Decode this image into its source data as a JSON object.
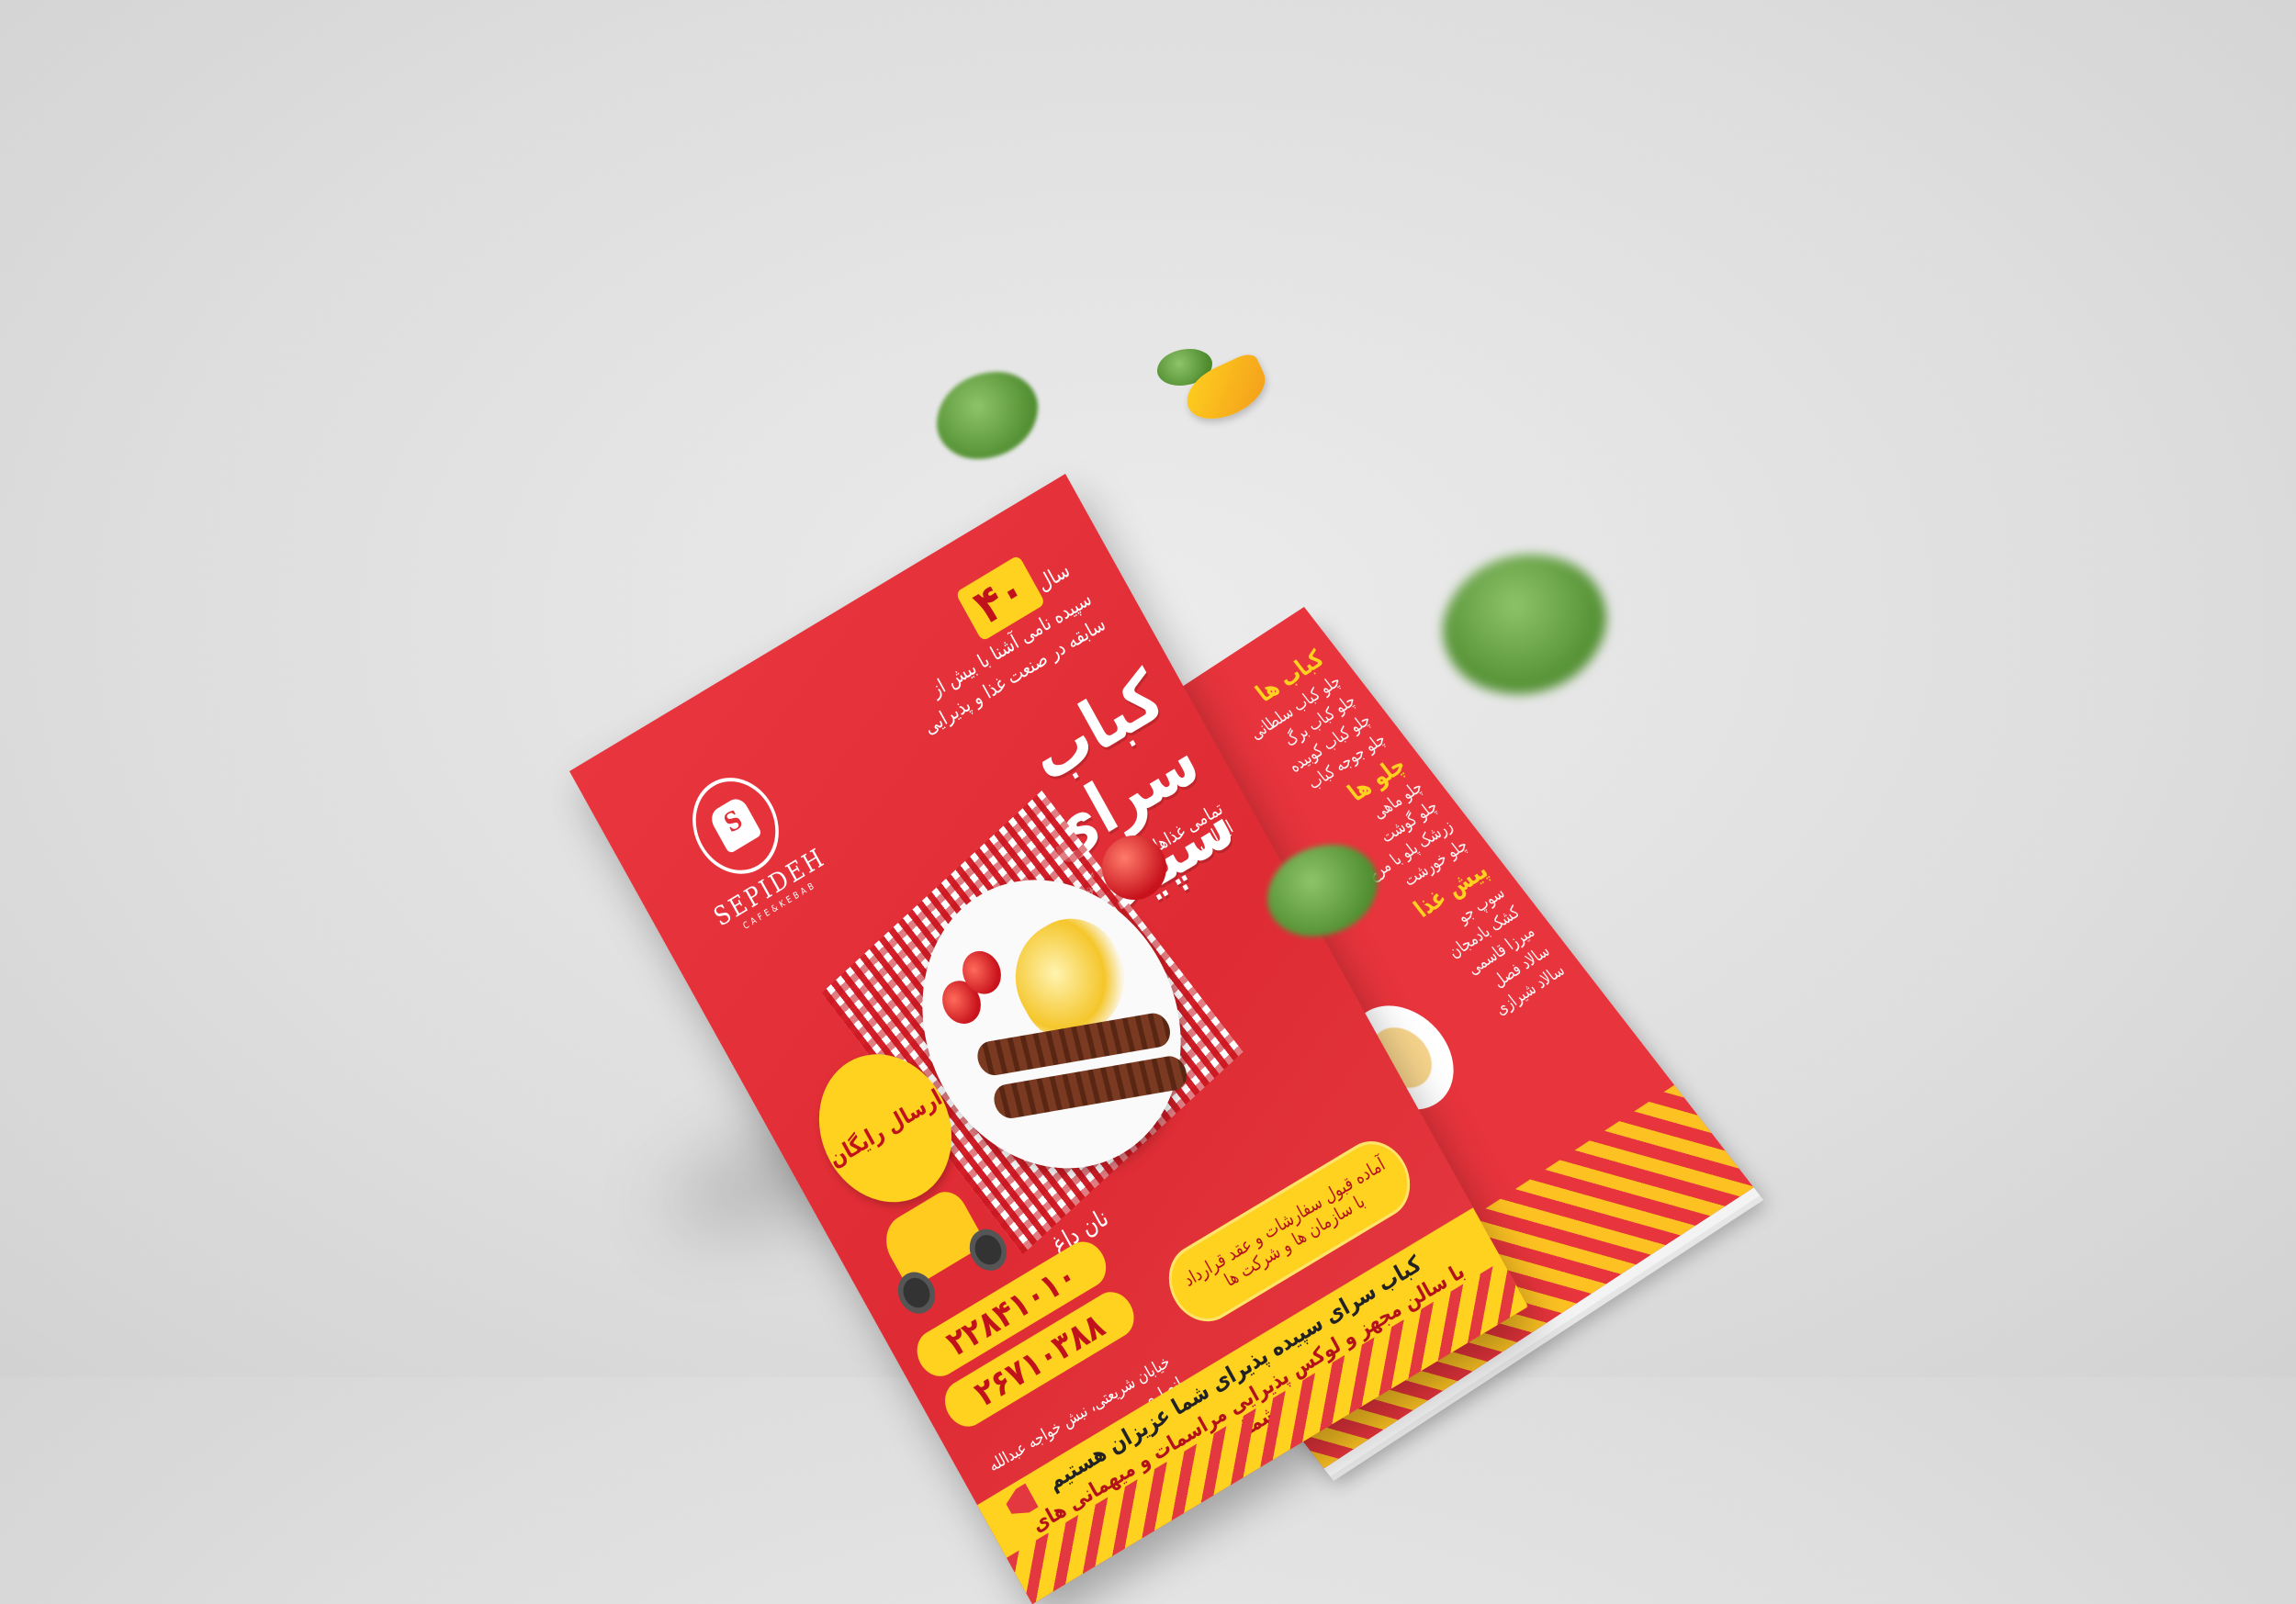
{
  "brand": {
    "logo_letter": "S",
    "logo_name": "SEPIDEH",
    "logo_sub": "CAFE&KEBAB"
  },
  "experience": {
    "number": "۴۰",
    "unit": "سال",
    "line1": "سپیده نامی آشنا با بیش از",
    "line2": "سابقه در صنعت غذا و پذیرایی"
  },
  "title": {
    "line1": "کباب سرای",
    "line2": "سپیده"
  },
  "tagline": "تمامی غذاها با گوشت گوسفندی و برنج ایرانی",
  "dish_name": "نان داغ",
  "free_delivery": "ارسال رایگان",
  "phones": [
    "۲۲۸۴۱۰۱۰",
    "۲۶۷۱۰۳۸۸"
  ],
  "address": {
    "line1": "خیابان شریعتی، نبش خواجه عبدالله انصاری",
    "line2": "کباب سرای سپیده"
  },
  "catering": {
    "line1": "آماده قبول سفارشات و عقد قرارداد",
    "line2": "با سازمان ها و شرکت ها"
  },
  "band": {
    "line1": "کباب سرای سپیده پذیرای شما عزیزان هستیم",
    "line2": "با سالن مجهز و لوکس پذیرایی مراسمات و میهمانی های شما"
  },
  "menu": {
    "section1": "کباب ها",
    "section1_items": [
      "چلو کباب سلطانی",
      "چلو کباب برگ",
      "چلو کباب کوبیده",
      "چلو جوجه کباب"
    ],
    "section2": "چلو ها",
    "section2_items": [
      "چلو ماهی",
      "چلو گوشت",
      "زرشک پلو با مرغ",
      "چلو خورشت"
    ],
    "section3": "پیش غذا",
    "section3_items": [
      "سوپ جو",
      "کشک بادمجان",
      "میرزا قاسمی",
      "سالاد فصل",
      "سالاد شیرازی"
    ]
  },
  "colors": {
    "background": "#dedede",
    "flyer_red": "#e33840",
    "accent_yellow": "#ffd21f",
    "text_white": "#ffffff"
  }
}
